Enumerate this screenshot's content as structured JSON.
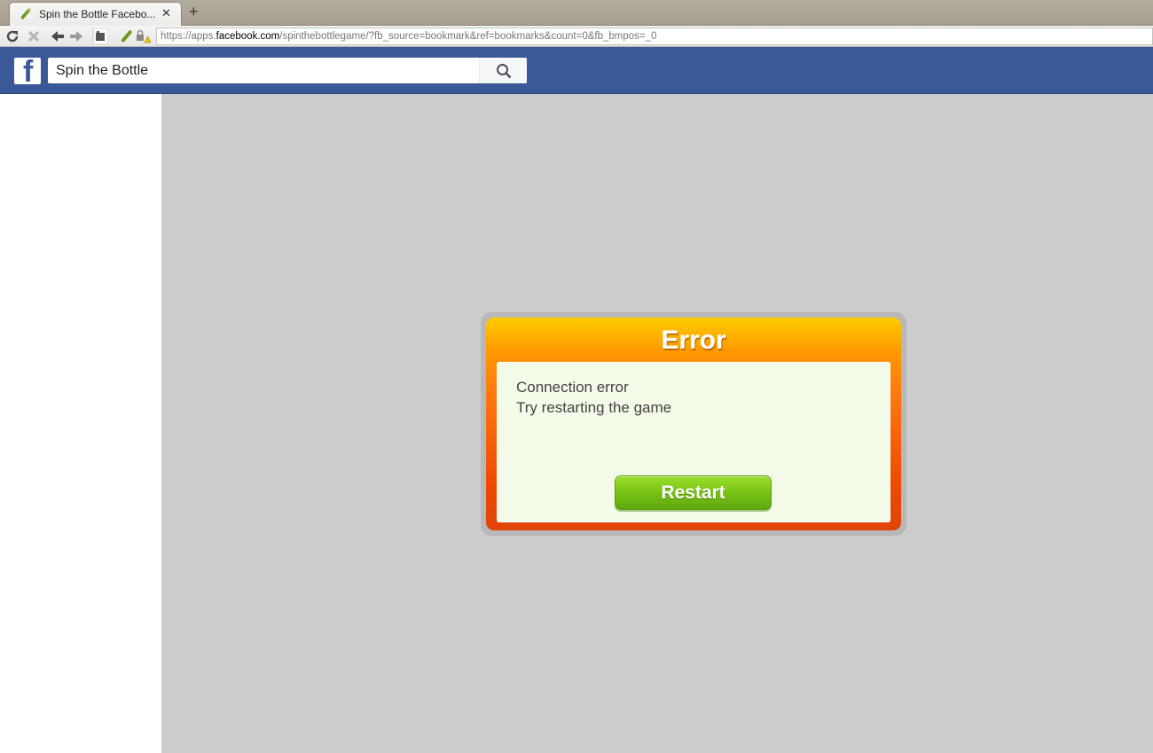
{
  "browser": {
    "tab_title": "Spin the Bottle Facebo...",
    "tab_close": "✕",
    "new_tab": "+",
    "url_prefix": "https://apps.",
    "url_host": "facebook.com",
    "url_path": "/spinthebottlegame/?fb_source=bookmark&ref=bookmarks&count=0&fb_bmpos=_0"
  },
  "facebook": {
    "logo_letter": "f",
    "search_value": "Spin the Bottle",
    "brand_color": "#3b5998"
  },
  "dialog": {
    "title": "Error",
    "line1": "Connection error",
    "line2": "Try restarting the game",
    "restart_label": "Restart"
  }
}
